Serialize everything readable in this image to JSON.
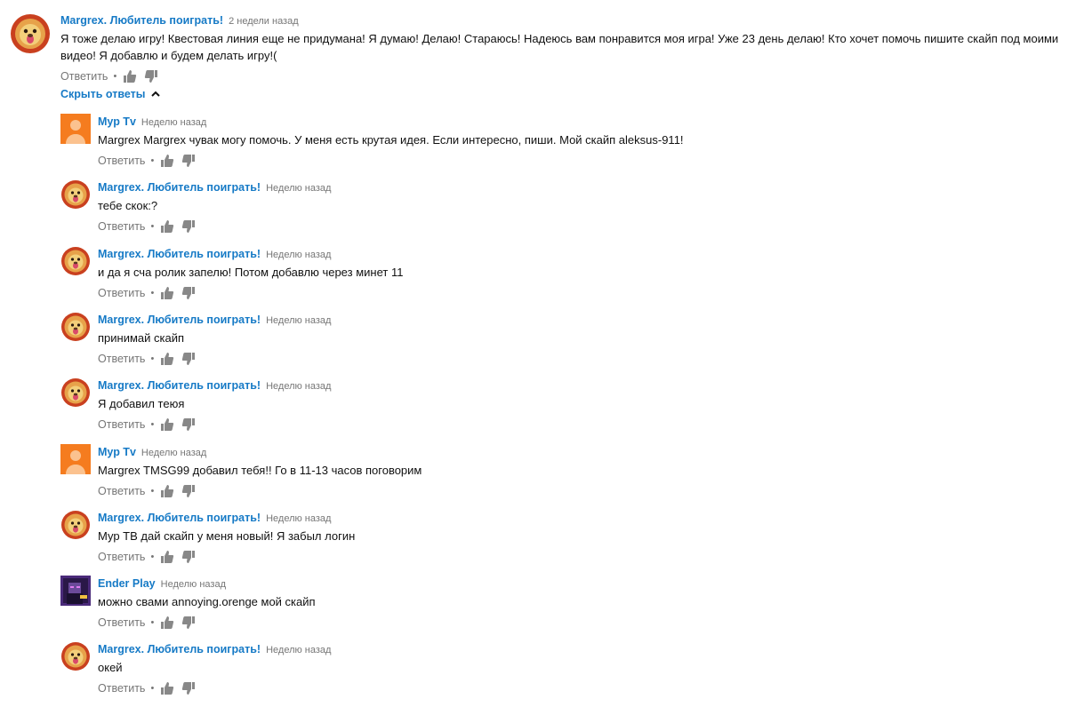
{
  "top_comment": {
    "author": "Margrex. Любитель поиграть!",
    "time": "2 недели назад",
    "text": "Я тоже делаю игру! Квестовая линия еще не придумана! Я думаю! Делаю! Стараюсь! Надеюсь вам понравится моя игра! Уже 23 день делаю! Кто хочет помочь пишите скайп под моими видео! Я добавлю и будем делать игру!(",
    "avatar_icon": "lion-avatar-icon"
  },
  "actions": {
    "reply_label": "Ответить",
    "separator": "•"
  },
  "hide_replies_label": "Скрыть ответы",
  "replies": [
    {
      "author": "Мур Tv",
      "time": "Неделю назад",
      "text": "Margrex Margrex чувак могу помочь. У меня есть крутая идея. Если интересно, пиши. Мой скайп aleksus-911!",
      "avatar": "orange-default-avatar-icon"
    },
    {
      "author": "Margrex. Любитель поиграть!",
      "time": "Неделю назад",
      "text": "тебе скок:?",
      "avatar": "lion-avatar-icon"
    },
    {
      "author": "Margrex. Любитель поиграть!",
      "time": "Неделю назад",
      "text": "и да я сча ролик запелю! Потом добавлю через минет 11",
      "avatar": "lion-avatar-icon"
    },
    {
      "author": "Margrex. Любитель поиграть!",
      "time": "Неделю назад",
      "text": "принимай скайп",
      "avatar": "lion-avatar-icon"
    },
    {
      "author": "Margrex. Любитель поиграть!",
      "time": "Неделю назад",
      "text": "Я добавил теюя",
      "avatar": "lion-avatar-icon"
    },
    {
      "author": "Мур Tv",
      "time": "Неделю назад",
      "text": "Margrex TMSG99 добавил тебя!! Го в 11-13 часов поговорим",
      "avatar": "orange-default-avatar-icon"
    },
    {
      "author": "Margrex. Любитель поиграть!",
      "time": "Неделю назад",
      "text": "Мур ТВ дай скайп у меня новый! Я забыл логин",
      "avatar": "lion-avatar-icon"
    },
    {
      "author": "Ender Play",
      "time": "Неделю назад",
      "text": "можно свами annoying.orenge мой скайп",
      "avatar": "ender-avatar-icon"
    },
    {
      "author": "Margrex. Любитель поиграть!",
      "time": "Неделю назад",
      "text": "окей",
      "avatar": "lion-avatar-icon"
    }
  ],
  "colors": {
    "link": "#167ac6",
    "meta": "#767676",
    "orange_avatar": "#f57c1f"
  }
}
